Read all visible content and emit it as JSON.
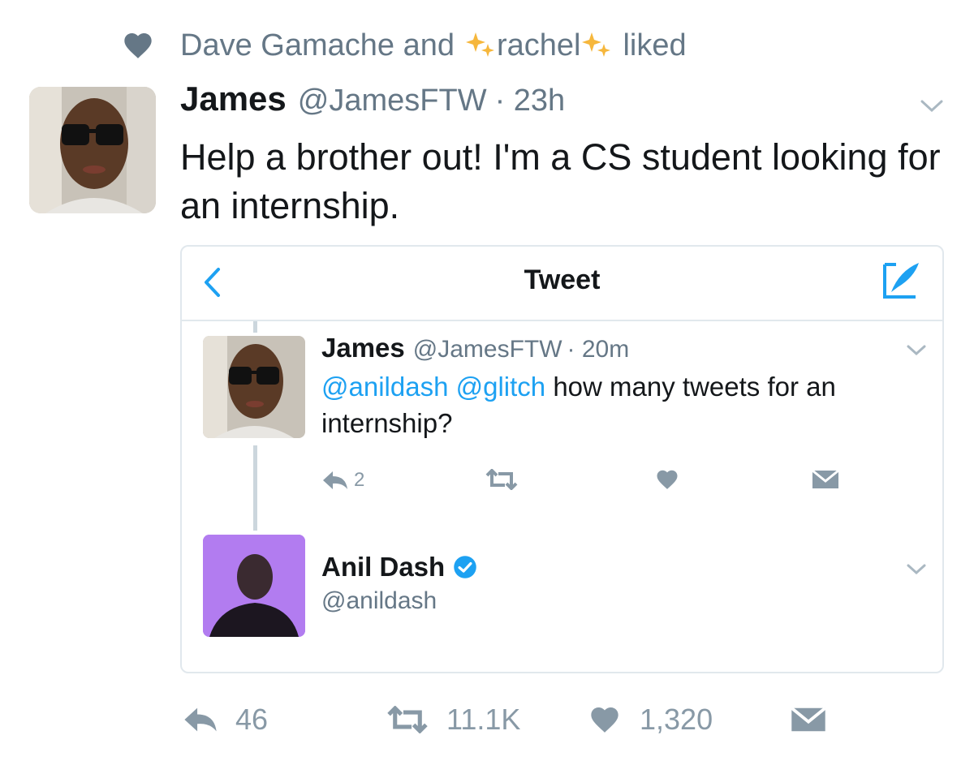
{
  "social_context": {
    "prefix": "Dave Gamache and",
    "name": "rachel",
    "suffix": "liked",
    "icon": "heart-icon"
  },
  "tweet": {
    "author_name": "James",
    "author_handle": "@JamesFTW",
    "time": "· 23h",
    "text": "Help a brother out! I'm a CS student looking for an internship.",
    "replies": "46",
    "retweets": "11.1K",
    "likes": "1,320"
  },
  "card": {
    "title": "Tweet",
    "reply": {
      "author_name": "James",
      "author_handle": "@JamesFTW",
      "time": "· 20m",
      "mention1": "@anildash",
      "mention2": "@glitch",
      "text": "how many tweets for an internship?",
      "reply_count": "2"
    },
    "user": {
      "name": "Anil Dash",
      "handle": "@anildash"
    }
  },
  "colors": {
    "accent": "#1da1f2",
    "muted": "#657786",
    "icon_gray": "#8899a6",
    "avatar_purple": "#b27cf0"
  }
}
